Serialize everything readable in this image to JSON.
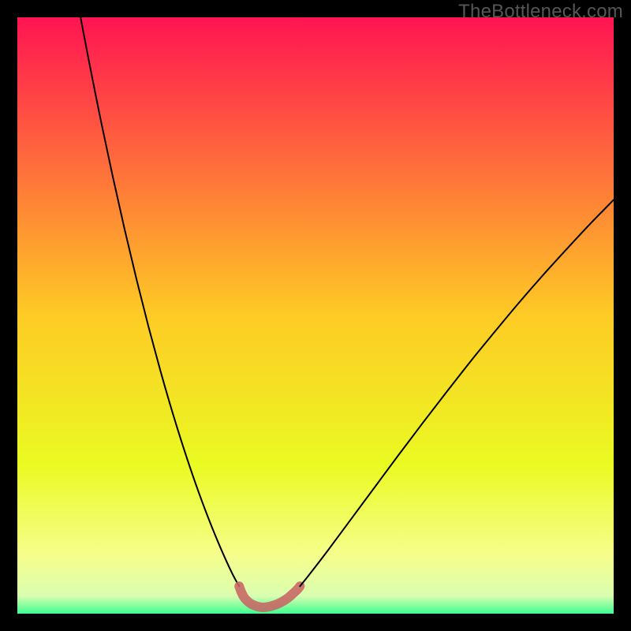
{
  "watermark": {
    "text": "TheBottleneck.com"
  },
  "chart_data": {
    "type": "line",
    "title": "",
    "xlabel": "",
    "ylabel": "",
    "xlim": [
      0,
      100
    ],
    "ylim": [
      0,
      100
    ],
    "grid": false,
    "series": [
      {
        "name": "left-branch",
        "x": [
          10.6,
          12,
          14,
          16,
          18,
          20,
          22,
          24,
          26,
          28,
          30,
          32,
          34,
          36,
          37.2
        ],
        "y": [
          100,
          92.7,
          82.7,
          73.3,
          64.4,
          56,
          48.1,
          40.7,
          33.8,
          27.4,
          21.5,
          16.1,
          11.2,
          6.8,
          4.6
        ],
        "color": "#000000"
      },
      {
        "name": "right-branch",
        "x": [
          47.4,
          49,
          52,
          56,
          60,
          64,
          68,
          72,
          76,
          80,
          84,
          88,
          92,
          96,
          100
        ],
        "y": [
          4.6,
          6.6,
          10.5,
          15.9,
          21.3,
          26.7,
          32.0,
          37.2,
          42.3,
          47.2,
          52.0,
          56.6,
          61.0,
          65.3,
          69.4
        ],
        "color": "#000000"
      },
      {
        "name": "bottom-lobe",
        "x": [
          37.2,
          37.6,
          38.2,
          39.4,
          41.2,
          43.4,
          45.2,
          46.4,
          47.0,
          47.4
        ],
        "y": [
          4.6,
          3.53,
          2.5,
          1.53,
          1.06,
          1.53,
          2.5,
          3.53,
          4.1,
          4.6
        ],
        "color": "#c86464"
      }
    ],
    "background_gradient": {
      "type": "vertical",
      "stops": [
        {
          "pos": 0.0,
          "color": "#ff1452"
        },
        {
          "pos": 0.25,
          "color": "#ff6e3b"
        },
        {
          "pos": 0.5,
          "color": "#fecb25"
        },
        {
          "pos": 0.75,
          "color": "#eafa22"
        },
        {
          "pos": 0.9,
          "color": "#f6fe8a"
        },
        {
          "pos": 0.97,
          "color": "#dafeb0"
        },
        {
          "pos": 1.0,
          "color": "#3efd91"
        }
      ]
    },
    "styles": {
      "branch_width": 2,
      "lobe_width": 12,
      "lobe_opacity": 0.88
    }
  }
}
